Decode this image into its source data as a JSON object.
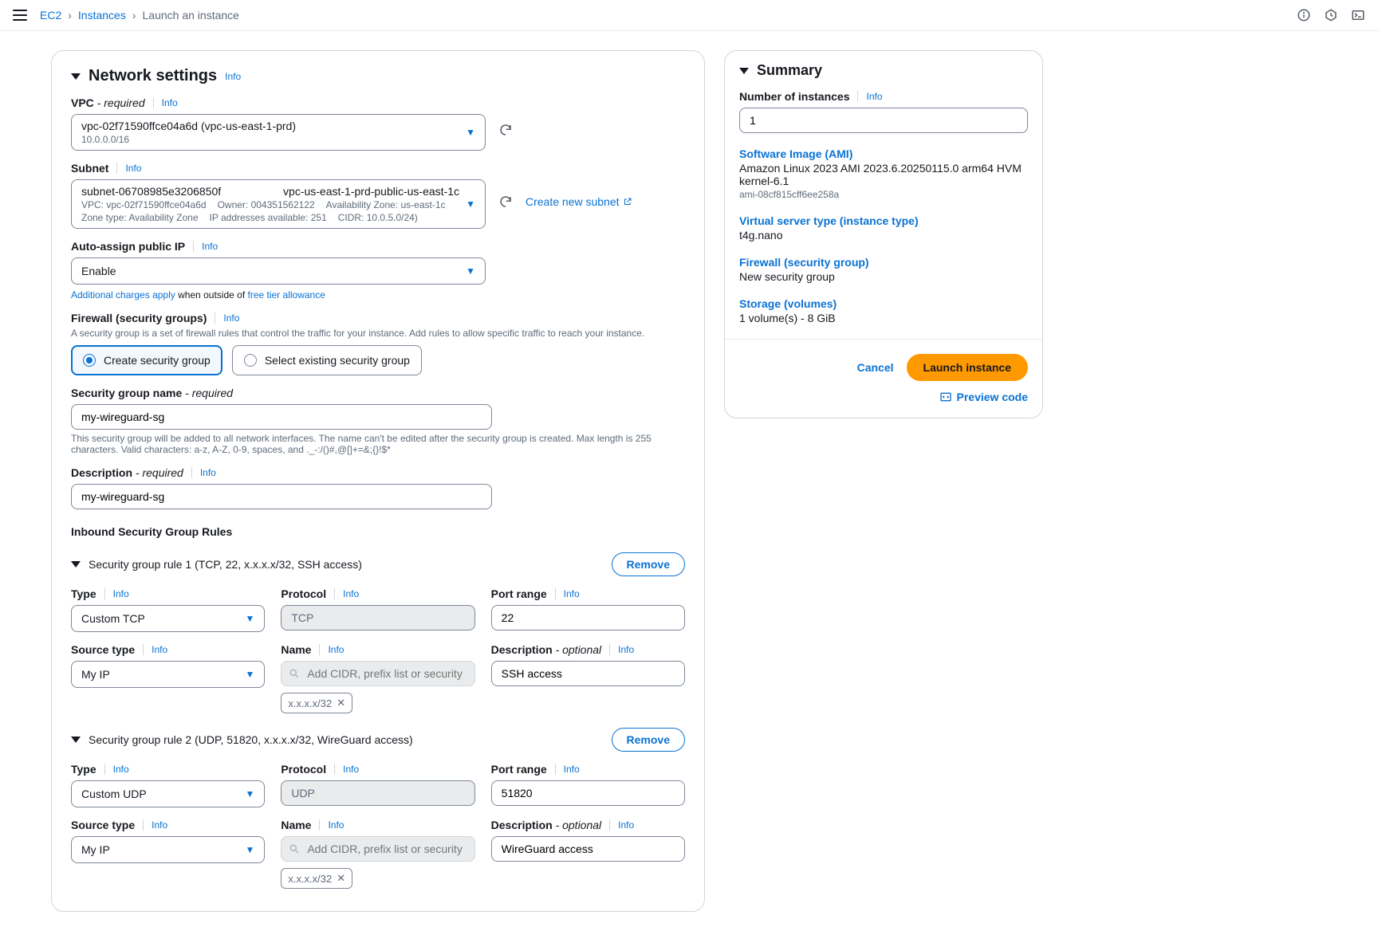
{
  "breadcrumb": {
    "ec2": "EC2",
    "instances": "Instances",
    "current": "Launch an instance"
  },
  "section": {
    "title": "Network settings",
    "info": "Info"
  },
  "vpc": {
    "label": "VPC",
    "req": "- required",
    "value": "vpc-02f71590ffce04a6d (vpc-us-east-1-prd)",
    "cidr": "10.0.0.0/16"
  },
  "subnet": {
    "label": "Subnet",
    "id": "subnet-06708985e3206850f",
    "name": "vpc-us-east-1-prd-public-us-east-1c",
    "meta_vpc": "VPC: vpc-02f71590ffce04a6d",
    "meta_owner": "Owner: 004351562122",
    "meta_az": "Availability Zone: us-east-1c",
    "meta_zone": "Zone type: Availability Zone",
    "meta_ips": "IP addresses available: 251",
    "meta_cidr": "CIDR: 10.0.5.0/24)",
    "create": "Create new subnet"
  },
  "autoip": {
    "label": "Auto-assign public IP",
    "value": "Enable",
    "notice_a": "Additional charges apply",
    "notice_mid": " when outside of ",
    "notice_b": "free tier allowance"
  },
  "firewall": {
    "label": "Firewall (security groups)",
    "help": "A security group is a set of firewall rules that control the traffic for your instance. Add rules to allow specific traffic to reach your instance.",
    "opt_create": "Create security group",
    "opt_select": "Select existing security group"
  },
  "sgname": {
    "label": "Security group name",
    "req": "- required",
    "value": "my-wireguard-sg",
    "help": "This security group will be added to all network interfaces. The name can't be edited after the security group is created. Max length is 255 characters. Valid characters: a-z, A-Z, 0-9, spaces, and ._-:/()#,@[]+=&;{}!$*"
  },
  "sgdesc": {
    "label": "Description",
    "req": "- required",
    "value": "my-wireguard-sg"
  },
  "inbound": {
    "title": "Inbound Security Group Rules"
  },
  "rule1": {
    "title": "Security group rule 1 (TCP, 22, x.x.x.x/32, SSH access)",
    "remove": "Remove",
    "type_label": "Type",
    "type_value": "Custom TCP",
    "proto_label": "Protocol",
    "proto_value": "TCP",
    "port_label": "Port range",
    "port_value": "22",
    "src_label": "Source type",
    "src_value": "My IP",
    "name_label": "Name",
    "name_placeholder": "Add CIDR, prefix list or security group",
    "chip": "x.x.x.x/32",
    "desc_label": "Description",
    "desc_opt": "- optional",
    "desc_value": "SSH access"
  },
  "rule2": {
    "title": "Security group rule 2 (UDP, 51820, x.x.x.x/32, WireGuard access)",
    "remove": "Remove",
    "type_value": "Custom UDP",
    "proto_value": "UDP",
    "port_value": "51820",
    "src_value": "My IP",
    "chip": "x.x.x.x/32",
    "desc_value": "WireGuard access"
  },
  "summary": {
    "title": "Summary",
    "num_label": "Number of instances",
    "num_value": "1",
    "ami_link": "Software Image (AMI)",
    "ami_text": "Amazon Linux 2023 AMI 2023.6.20250115.0 arm64 HVM kernel-6.1",
    "ami_id": "ami-08cf815cff6ee258a",
    "type_link": "Virtual server type (instance type)",
    "type_text": "t4g.nano",
    "fw_link": "Firewall (security group)",
    "fw_text": "New security group",
    "storage_link": "Storage (volumes)",
    "storage_text": "1 volume(s) - 8 GiB",
    "cancel": "Cancel",
    "launch": "Launch instance",
    "preview": "Preview code"
  }
}
